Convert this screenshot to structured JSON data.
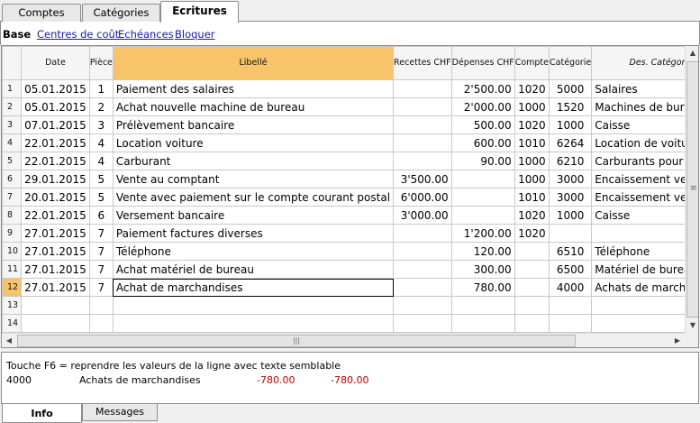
{
  "top_tabs": [
    "Comptes",
    "Catégories",
    "Ecritures"
  ],
  "active_top_tab": 2,
  "sublinks": [
    "Base",
    "Centres de coût",
    "Echéances",
    "Bloquer"
  ],
  "columns": {
    "date": "Date",
    "piece": "Pièce",
    "libelle": "Libellé",
    "recettes": "Recettes CHF",
    "depenses": "Dépenses CHF",
    "compte": "Compte",
    "categorie": "Catégorie",
    "des_categorie": "Des. Catégorie"
  },
  "rows": [
    {
      "n": "1",
      "date": "05.01.2015",
      "piece": "1",
      "libelle": "Paiement des salaires",
      "recettes": "",
      "depenses": "2'500.00",
      "compte": "1020",
      "categorie": "5000",
      "des": "Salaires"
    },
    {
      "n": "2",
      "date": "05.01.2015",
      "piece": "2",
      "libelle": "Achat nouvelle machine de bureau",
      "recettes": "",
      "depenses": "2'000.00",
      "compte": "1000",
      "categorie": "1520",
      "des": "Machines de bureau"
    },
    {
      "n": "3",
      "date": "07.01.2015",
      "piece": "3",
      "libelle": "Prélèvement bancaire",
      "recettes": "",
      "depenses": "500.00",
      "compte": "1020",
      "categorie": "1000",
      "des": "Caisse"
    },
    {
      "n": "4",
      "date": "22.01.2015",
      "piece": "4",
      "libelle": "Location voiture",
      "recettes": "",
      "depenses": "600.00",
      "compte": "1010",
      "categorie": "6264",
      "des": "Location de voitures"
    },
    {
      "n": "5",
      "date": "22.01.2015",
      "piece": "4",
      "libelle": "Carburant",
      "recettes": "",
      "depenses": "90.00",
      "compte": "1000",
      "categorie": "6210",
      "des": "Carburants pour voiture"
    },
    {
      "n": "6",
      "date": "29.01.2015",
      "piece": "5",
      "libelle": "Vente au comptant",
      "recettes": "3'500.00",
      "depenses": "",
      "compte": "1000",
      "categorie": "3000",
      "des": "Encaissement ventes"
    },
    {
      "n": "7",
      "date": "20.01.2015",
      "piece": "5",
      "libelle": "Vente avec paiement sur le compte courant postal",
      "recettes": "6'000.00",
      "depenses": "",
      "compte": "1010",
      "categorie": "3000",
      "des": "Encaissement ventes"
    },
    {
      "n": "8",
      "date": "22.01.2015",
      "piece": "6",
      "libelle": "Versement bancaire",
      "recettes": "3'000.00",
      "depenses": "",
      "compte": "1020",
      "categorie": "1000",
      "des": "Caisse"
    },
    {
      "n": "9",
      "date": "27.01.2015",
      "piece": "7",
      "libelle": "Paiement factures diverses",
      "recettes": "",
      "depenses": "1'200.00",
      "compte": "1020",
      "categorie": "",
      "des": ""
    },
    {
      "n": "10",
      "date": "27.01.2015",
      "piece": "7",
      "libelle": "Téléphone",
      "recettes": "",
      "depenses": "120.00",
      "compte": "",
      "categorie": "6510",
      "des": "Téléphone"
    },
    {
      "n": "11",
      "date": "27.01.2015",
      "piece": "7",
      "libelle": "Achat matériel de bureau",
      "recettes": "",
      "depenses": "300.00",
      "compte": "",
      "categorie": "6500",
      "des": "Matériel de bureau"
    },
    {
      "n": "12",
      "date": "27.01.2015",
      "piece": "7",
      "libelle": "Achat de marchandises",
      "recettes": "",
      "depenses": "780.00",
      "compte": "",
      "categorie": "4000",
      "des": "Achats de marchandises"
    },
    {
      "n": "13",
      "date": "",
      "piece": "",
      "libelle": "",
      "recettes": "",
      "depenses": "",
      "compte": "",
      "categorie": "",
      "des": ""
    },
    {
      "n": "14",
      "date": "",
      "piece": "",
      "libelle": "",
      "recettes": "",
      "depenses": "",
      "compte": "",
      "categorie": "",
      "des": ""
    }
  ],
  "selected_row": 11,
  "info": {
    "line1": "Touche F6 = reprendre les valeurs de la ligne avec texte semblable",
    "account": "4000",
    "account_name": "Achats de marchandises",
    "amount1": "-780.00",
    "amount2": "-780.00"
  },
  "bottom_tabs": [
    "Info",
    "Messages"
  ],
  "scroll_glyphs": {
    "up": "▲",
    "down": "▼",
    "left": "◀",
    "right": "▶",
    "vgrip": "≡",
    "hgrip": "|||"
  }
}
